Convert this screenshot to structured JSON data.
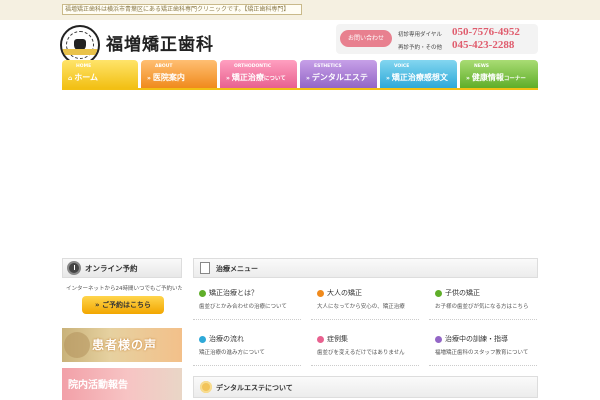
{
  "topbar": {
    "tagline": "福増矯正歯科は横浜市青葉区にある矯正歯科専門クリニックです。【矯正歯科専門】"
  },
  "logo": {
    "title": "福増矯正歯科"
  },
  "contact": {
    "button": "お問い合わせ",
    "label1": "初診専用ダイヤル",
    "tel1": "050-7576-4952",
    "label2": "再診予約・その他",
    "tel2": "045-423-2288"
  },
  "nav": [
    {
      "en": "HOME",
      "jp": "ホーム",
      "color": "#f2c014"
    },
    {
      "en": "ABOUT",
      "jp": "医院案内",
      "color": "#f08a1c"
    },
    {
      "en": "ORTHODONTIC",
      "jp": "矯正治療",
      "suffix": "について",
      "color": "#e8618f"
    },
    {
      "en": "ESTHETICS",
      "jp": "デンタルエステ",
      "color": "#9366c6"
    },
    {
      "en": "VOICE",
      "jp": "矯正治療感想文",
      "color": "#2ea9d8"
    },
    {
      "en": "NEWS",
      "jp": "健康情報",
      "suffix": "コーナー",
      "color": "#5fae29"
    }
  ],
  "sidebar": {
    "reserve_title": "オンライン予約",
    "reserve_text": "インターネットから24時間いつでもご予約いただけます。",
    "reserve_button": "ご予約はこちら",
    "banner1": "患者様の声",
    "banner2": "院内活動報告"
  },
  "treatment": {
    "title": "治療メニュー",
    "items": [
      {
        "title": "矯正治療とは？",
        "desc": "歯並びとかみ合わせの治療について",
        "color": "#5fae29"
      },
      {
        "title": "大人の矯正",
        "desc": "大人になってから安心の、矯正治療",
        "color": "#f08a1c"
      },
      {
        "title": "子供の矯正",
        "desc": "お子様の歯並びが気になる方はこちら",
        "color": "#5fae29"
      },
      {
        "title": "治療の流れ",
        "desc": "矯正治療の進み方について",
        "color": "#2ea9d8"
      },
      {
        "title": "症例集",
        "desc": "歯並びを変えるだけではありません",
        "color": "#e8618f"
      },
      {
        "title": "治療中の訓練・指導",
        "desc": "福増矯正歯科のスタッフ教育について",
        "color": "#9366c6"
      }
    ]
  },
  "esthetics": {
    "title": "デンタルエステについて"
  }
}
